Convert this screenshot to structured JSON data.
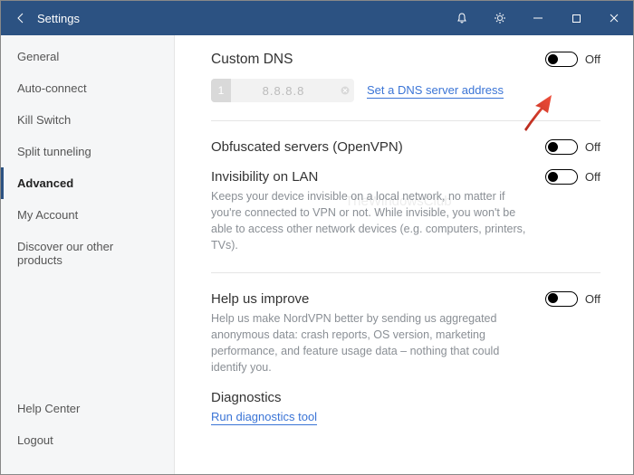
{
  "titlebar": {
    "title": "Settings"
  },
  "sidebar": {
    "items": [
      {
        "label": "General"
      },
      {
        "label": "Auto-connect"
      },
      {
        "label": "Kill Switch"
      },
      {
        "label": "Split tunneling"
      },
      {
        "label": "Advanced"
      },
      {
        "label": "My Account"
      },
      {
        "label": "Discover our other products"
      }
    ],
    "bottom": [
      {
        "label": "Help Center"
      },
      {
        "label": "Logout"
      }
    ]
  },
  "content": {
    "custom_dns": {
      "heading": "Custom DNS",
      "toggle_state": "Off",
      "server_index": "1",
      "server_value": "8.8.8.8",
      "set_link": "Set a DNS server address"
    },
    "obfuscated": {
      "heading": "Obfuscated servers (OpenVPN)",
      "toggle_state": "Off"
    },
    "invisibility": {
      "heading": "Invisibility on LAN",
      "toggle_state": "Off",
      "desc": "Keeps your device invisible on a local network, no matter if you're connected to VPN or not. While invisible, you won't be able to access other network devices (e.g. computers, printers, TVs)."
    },
    "help_improve": {
      "heading": "Help us improve",
      "toggle_state": "Off",
      "desc": "Help us make NordVPN better by sending us aggregated anonymous data: crash reports, OS version, marketing performance, and feature usage data – nothing that could identify you."
    },
    "diagnostics": {
      "heading": "Diagnostics",
      "link": "Run diagnostics tool"
    }
  },
  "watermark": "TheWindowsClub"
}
